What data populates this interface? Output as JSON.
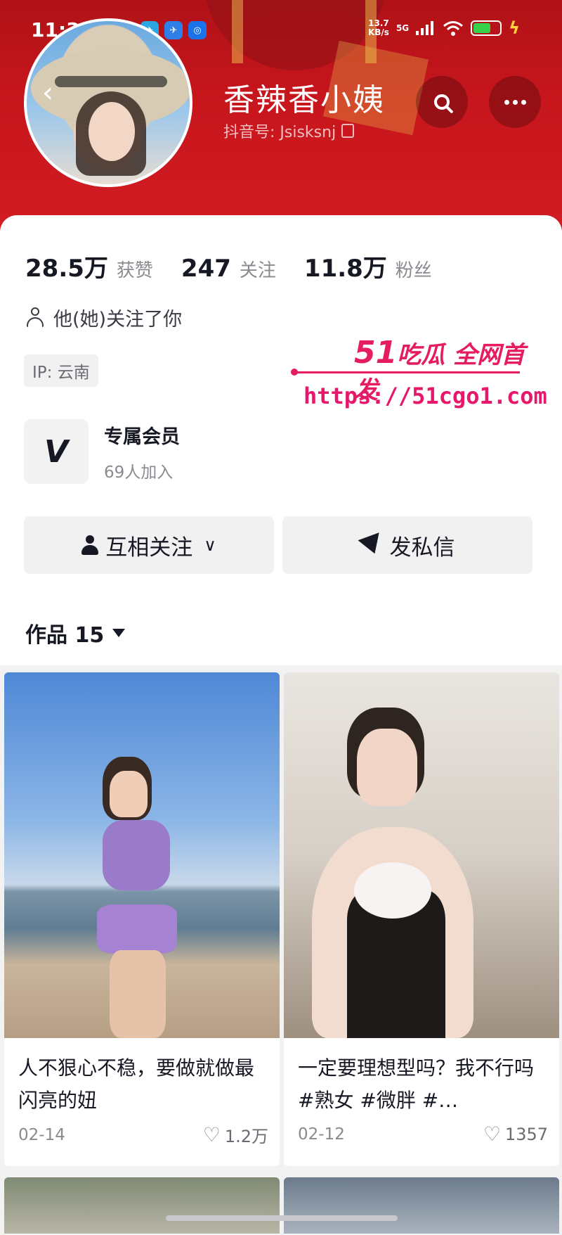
{
  "status_bar": {
    "time": "11:31",
    "net_speed_value": "13.7",
    "net_speed_unit": "KB/s",
    "network": "5G",
    "app_icons": [
      "e",
      "▶",
      "✈",
      "✈",
      "◎"
    ]
  },
  "profile": {
    "name": "香辣香小姨",
    "douyin_id": "抖音号: Jsisksnj"
  },
  "stats": [
    {
      "value": "28.5万",
      "label": "获赞"
    },
    {
      "value": "247",
      "label": "关注"
    },
    {
      "value": "11.8万",
      "label": "粉丝"
    }
  ],
  "follows_you": "他(她)关注了你",
  "ip_location": "IP: 云南",
  "watermark": {
    "title_number": "51",
    "title_text": "吃瓜 全网首发",
    "url": "https://51cgo1.com"
  },
  "membership": {
    "icon": "V",
    "title": "专属会员",
    "subtitle": "69人加入"
  },
  "actions": {
    "mutual_follow": "互相关注",
    "chevron": "∨",
    "message": "发私信"
  },
  "works_tab": "作品 15",
  "videos": [
    {
      "caption": "人不狠心不稳，要做就做最闪亮的妞",
      "date": "02-14",
      "likes": "1.2万"
    },
    {
      "caption": "一定要理想型吗？我不行吗#熟女 #微胖 #…",
      "date": "02-12",
      "likes": "1357"
    }
  ],
  "icons": {
    "back": "‹",
    "heart": "♡"
  },
  "colors": {
    "header_red": "#c8161d",
    "watermark_pink": "#e51c62",
    "battery_green": "#35d04c"
  }
}
